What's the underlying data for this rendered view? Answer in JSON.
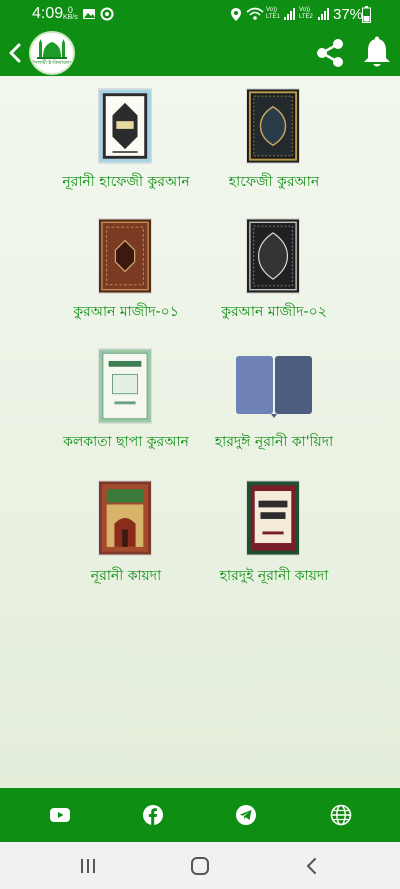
{
  "status": {
    "time": "4:09",
    "speed_value": "0",
    "speed_unit": "KB/s",
    "net1_top": "Vo))",
    "net1_bottom": "LTE1",
    "net2_top": "Vo))",
    "net2_bottom": "LTE2",
    "battery": "37%"
  },
  "appbar": {
    "logo_text": "ইসলামী ই-কিতাবলয়"
  },
  "books": [
    {
      "label": "নূরানী হাফেজী কুরআন"
    },
    {
      "label": "হাফেজী কুরআন"
    },
    {
      "label": "কুরআন মাজীদ-০১"
    },
    {
      "label": "কুরআন মাজীদ-০২"
    },
    {
      "label": "কলকাতা ছাপা কুরআন"
    },
    {
      "label": "হারদুঈ নূরানী কা'য়িদা"
    },
    {
      "label": "নূরানী কায়দা"
    },
    {
      "label": "হারদুই নূরানী কায়দা"
    }
  ],
  "colors": {
    "primary": "#0e8e12",
    "label": "#0e8e12",
    "background": "#e6efdc"
  },
  "icons": {
    "back": "chevron-left-icon",
    "share": "share-icon",
    "notification": "bell-icon",
    "youtube": "youtube-icon",
    "facebook": "facebook-icon",
    "telegram": "telegram-icon",
    "web": "globe-icon"
  }
}
